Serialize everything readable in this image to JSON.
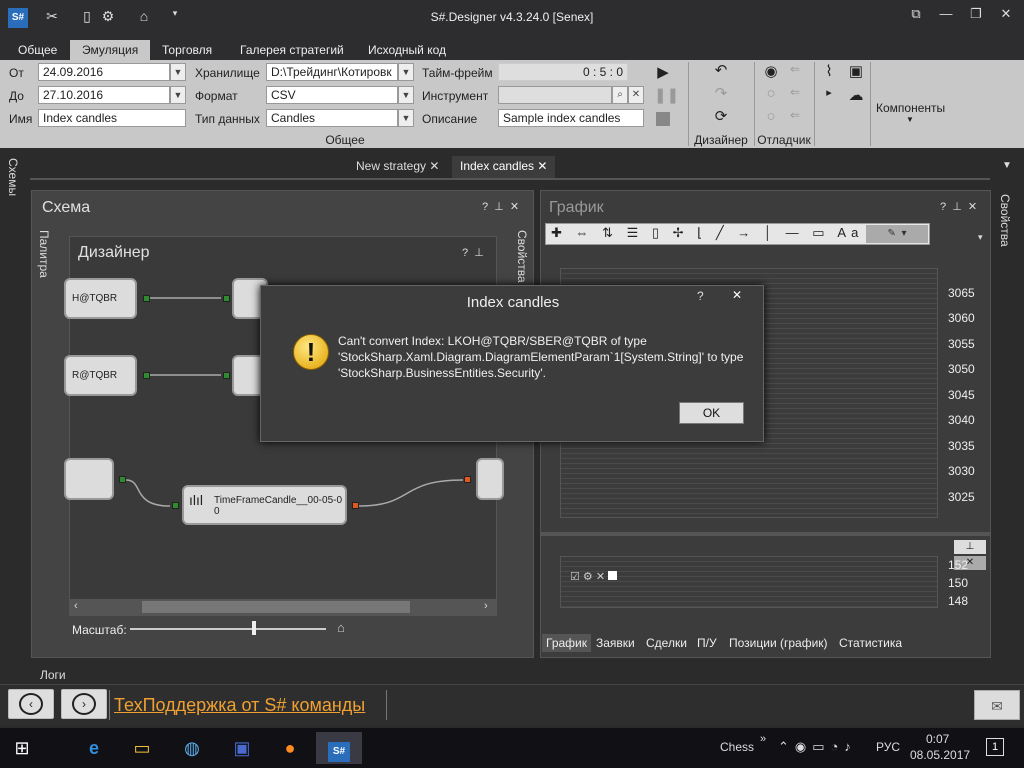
{
  "window": {
    "title": "S#.Designer v4.3.24.0 [Senex]"
  },
  "ribbon_tabs": [
    "Общее",
    "Эмуляция",
    "Торговля",
    "Галерея стратегий",
    "Исходный код"
  ],
  "ribbon": {
    "from_label": "От",
    "from_value": "24.09.2016",
    "to_label": "До",
    "to_value": "27.10.2016",
    "name_label": "Имя",
    "name_value": "Index candles",
    "storage_label": "Хранилище",
    "storage_value": "D:\\Трейдинг\\Котировк",
    "format_label": "Формат",
    "format_value": "CSV",
    "datatype_label": "Тип данных",
    "datatype_value": "Candles",
    "timeframe_label": "Тайм-фрейм",
    "timeframe_value": "0 : 5 : 0",
    "instrument_label": "Инструмент",
    "instrument_value": "",
    "description_label": "Описание",
    "description_value": "Sample index candles",
    "group_general": "Общее",
    "group_designer": "Дизайнер",
    "group_debugger": "Отладчик",
    "components": "Компоненты"
  },
  "doc_tabs": [
    "New strategy",
    "Index candles"
  ],
  "side": {
    "schemes": "Схемы",
    "palette": "Палитра",
    "properties": "Свойства"
  },
  "schema": {
    "title": "Схема",
    "designer_title": "Дизайнер",
    "scale_label": "Масштаб:"
  },
  "nodes": {
    "n1": "H@TQBR",
    "n2": "R@TQBR",
    "tf": "TimeFrameCandle__00-05-0",
    "tf2": "0"
  },
  "chart": {
    "title": "График",
    "y_ticks": [
      "3065",
      "3060",
      "3055",
      "3050",
      "3045",
      "3040",
      "3035",
      "3030",
      "3025"
    ],
    "y_ticks2": [
      "152",
      "150",
      "148"
    ]
  },
  "bottom_tabs": [
    "График",
    "Заявки",
    "Сделки",
    "П/У",
    "Позиции (график)",
    "Статистика"
  ],
  "logs": "Логи",
  "support_link": "ТехПоддержка от S# команды",
  "dialog": {
    "title": "Index candles",
    "help": "?",
    "close": "✕",
    "message_l1": "Can't convert Index: LKOH@TQBR/SBER@TQBR of type",
    "message_l2": "'StockSharp.Xaml.Diagram.DiagramElementParam`1[System.String]' to type",
    "message_l3": "'StockSharp.BusinessEntities.Security'.",
    "ok": "OK"
  },
  "taskbar": {
    "lang_text": "Chess",
    "lang": "РУС",
    "time": "0:07",
    "date": "08.05.2017",
    "notif": "1"
  }
}
